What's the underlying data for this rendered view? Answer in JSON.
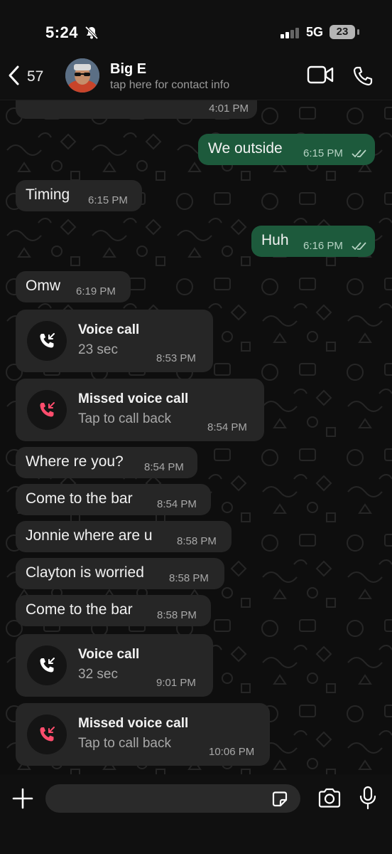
{
  "status_bar": {
    "time": "5:24",
    "network": "5G",
    "battery": "23"
  },
  "header": {
    "back_count": "57",
    "contact_name": "Big E",
    "contact_subtitle": "tap here for contact info"
  },
  "messages": [
    {
      "type": "text",
      "direction": "in",
      "text": "",
      "time": "4:01 PM"
    },
    {
      "type": "text",
      "direction": "out",
      "text": "We outside",
      "time": "6:15 PM",
      "read": true
    },
    {
      "type": "text",
      "direction": "in",
      "text": "Timing",
      "time": "6:15 PM"
    },
    {
      "type": "text",
      "direction": "out",
      "text": "Huh",
      "time": "6:16 PM",
      "read": true
    },
    {
      "type": "text",
      "direction": "in",
      "text": "Omw",
      "time": "6:19 PM"
    },
    {
      "type": "call",
      "direction": "in",
      "title": "Voice call",
      "subtitle": "23 sec",
      "time": "8:53 PM",
      "missed": false
    },
    {
      "type": "call",
      "direction": "in",
      "title": "Missed voice call",
      "subtitle": "Tap to call back",
      "time": "8:54 PM",
      "missed": true
    },
    {
      "type": "text",
      "direction": "in",
      "text": "Where re you?",
      "time": "8:54 PM"
    },
    {
      "type": "text",
      "direction": "in",
      "text": "Come to the bar",
      "time": "8:54 PM"
    },
    {
      "type": "text",
      "direction": "in",
      "text": "Jonnie where are u",
      "time": "8:58 PM"
    },
    {
      "type": "text",
      "direction": "in",
      "text": "Clayton is worried",
      "time": "8:58 PM"
    },
    {
      "type": "text",
      "direction": "in",
      "text": "Come to the bar",
      "time": "8:58 PM"
    },
    {
      "type": "call",
      "direction": "in",
      "title": "Voice call",
      "subtitle": "32 sec",
      "time": "9:01 PM",
      "missed": false
    },
    {
      "type": "call",
      "direction": "in",
      "title": "Missed voice call",
      "subtitle": "Tap to call back",
      "time": "10:06 PM",
      "missed": true
    }
  ],
  "input": {
    "value": "",
    "placeholder": ""
  },
  "icons": {
    "status": [
      "bell-slash-icon",
      "signal-icon"
    ],
    "header": [
      "chevron-left-icon",
      "video-camera-icon",
      "phone-icon"
    ],
    "call": [
      "incoming-call-icon",
      "missed-call-icon"
    ],
    "input": [
      "plus-icon",
      "sticker-icon",
      "camera-icon",
      "microphone-icon"
    ]
  },
  "colors": {
    "background": "#0b0b0b",
    "incoming_bubble": "#262626",
    "outgoing_bubble": "#1d5a3c",
    "missed_call": "#ff4d6d",
    "read_ticks": "#b7d3c4"
  }
}
